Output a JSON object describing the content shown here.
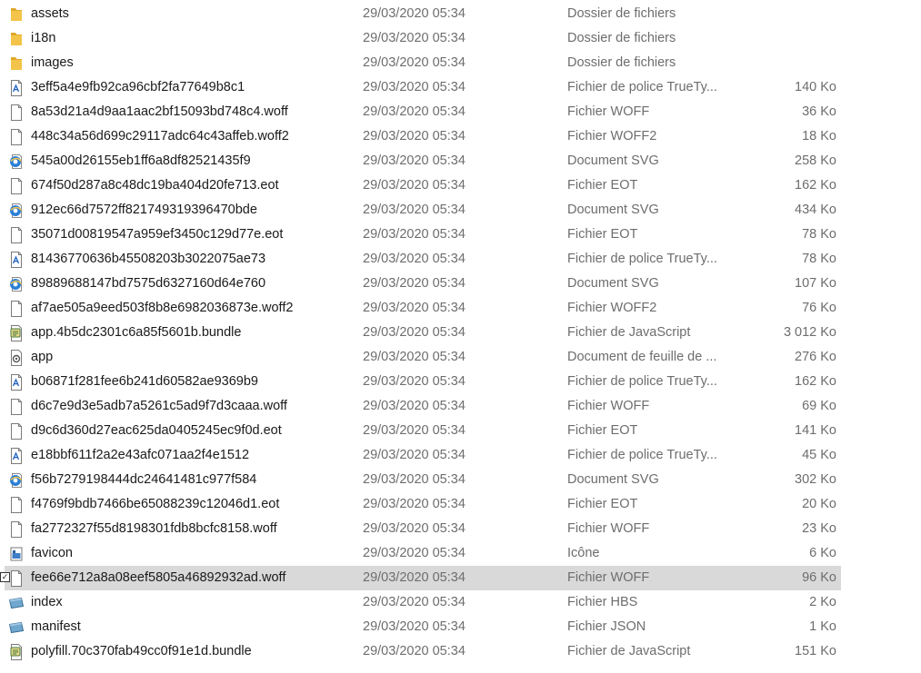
{
  "files": [
    {
      "name": "assets",
      "date": "29/03/2020 05:34",
      "type": "Dossier de fichiers",
      "size": "",
      "icon": "folder-icon"
    },
    {
      "name": "i18n",
      "date": "29/03/2020 05:34",
      "type": "Dossier de fichiers",
      "size": "",
      "icon": "folder-icon"
    },
    {
      "name": "images",
      "date": "29/03/2020 05:34",
      "type": "Dossier de fichiers",
      "size": "",
      "icon": "folder-icon"
    },
    {
      "name": "3eff5a4e9fb92ca96cbf2fa77649b8c1",
      "date": "29/03/2020 05:34",
      "type": "Fichier de police TrueTy...",
      "size": "140 Ko",
      "icon": "font-file-icon"
    },
    {
      "name": "8a53d21a4d9aa1aac2bf15093bd748c4.woff",
      "date": "29/03/2020 05:34",
      "type": "Fichier WOFF",
      "size": "36 Ko",
      "icon": "blank-file-icon"
    },
    {
      "name": "448c34a56d699c29117adc64c43affeb.woff2",
      "date": "29/03/2020 05:34",
      "type": "Fichier WOFF2",
      "size": "18 Ko",
      "icon": "blank-file-icon"
    },
    {
      "name": "545a00d26155eb1ff6a8df82521435f9",
      "date": "29/03/2020 05:34",
      "type": "Document SVG",
      "size": "258 Ko",
      "icon": "browser-document-icon"
    },
    {
      "name": "674f50d287a8c48dc19ba404d20fe713.eot",
      "date": "29/03/2020 05:34",
      "type": "Fichier EOT",
      "size": "162 Ko",
      "icon": "blank-file-icon"
    },
    {
      "name": "912ec66d7572ff821749319396470bde",
      "date": "29/03/2020 05:34",
      "type": "Document SVG",
      "size": "434 Ko",
      "icon": "browser-document-icon"
    },
    {
      "name": "35071d00819547a959ef3450c129d77e.eot",
      "date": "29/03/2020 05:34",
      "type": "Fichier EOT",
      "size": "78 Ko",
      "icon": "blank-file-icon"
    },
    {
      "name": "81436770636b45508203b3022075ae73",
      "date": "29/03/2020 05:34",
      "type": "Fichier de police TrueTy...",
      "size": "78 Ko",
      "icon": "font-file-icon"
    },
    {
      "name": "89889688147bd7575d6327160d64e760",
      "date": "29/03/2020 05:34",
      "type": "Document SVG",
      "size": "107 Ko",
      "icon": "browser-document-icon"
    },
    {
      "name": "af7ae505a9eed503f8b8e6982036873e.woff2",
      "date": "29/03/2020 05:34",
      "type": "Fichier WOFF2",
      "size": "76 Ko",
      "icon": "blank-file-icon"
    },
    {
      "name": "app.4b5dc2301c6a85f5601b.bundle",
      "date": "29/03/2020 05:34",
      "type": "Fichier de JavaScript",
      "size": "3 012 Ko",
      "icon": "script-file-icon"
    },
    {
      "name": "app",
      "date": "29/03/2020 05:34",
      "type": "Document de feuille de ...",
      "size": "276 Ko",
      "icon": "stylesheet-file-icon"
    },
    {
      "name": "b06871f281fee6b241d60582ae9369b9",
      "date": "29/03/2020 05:34",
      "type": "Fichier de police TrueTy...",
      "size": "162 Ko",
      "icon": "font-file-icon"
    },
    {
      "name": "d6c7e9d3e5adb7a5261c5ad9f7d3caaa.woff",
      "date": "29/03/2020 05:34",
      "type": "Fichier WOFF",
      "size": "69 Ko",
      "icon": "blank-file-icon"
    },
    {
      "name": "d9c6d360d27eac625da0405245ec9f0d.eot",
      "date": "29/03/2020 05:34",
      "type": "Fichier EOT",
      "size": "141 Ko",
      "icon": "blank-file-icon"
    },
    {
      "name": "e18bbf611f2a2e43afc071aa2f4e1512",
      "date": "29/03/2020 05:34",
      "type": "Fichier de police TrueTy...",
      "size": "45 Ko",
      "icon": "font-file-icon"
    },
    {
      "name": "f56b7279198444dc24641481c977f584",
      "date": "29/03/2020 05:34",
      "type": "Document SVG",
      "size": "302 Ko",
      "icon": "browser-document-icon"
    },
    {
      "name": "f4769f9bdb7466be65088239c12046d1.eot",
      "date": "29/03/2020 05:34",
      "type": "Fichier EOT",
      "size": "20 Ko",
      "icon": "blank-file-icon"
    },
    {
      "name": "fa2772327f55d8198301fdb8bcfc8158.woff",
      "date": "29/03/2020 05:34",
      "type": "Fichier WOFF",
      "size": "23 Ko",
      "icon": "blank-file-icon"
    },
    {
      "name": "favicon",
      "date": "29/03/2020 05:34",
      "type": "Icône",
      "size": "6 Ko",
      "icon": "image-icon-file-icon"
    },
    {
      "name": "fee66e712a8a08eef5805a46892932ad.woff",
      "date": "29/03/2020 05:34",
      "type": "Fichier WOFF",
      "size": "96 Ko",
      "icon": "blank-file-icon",
      "selected": true
    },
    {
      "name": "index",
      "date": "29/03/2020 05:34",
      "type": "Fichier HBS",
      "size": "2 Ko",
      "icon": "generic-app-file-icon"
    },
    {
      "name": "manifest",
      "date": "29/03/2020 05:34",
      "type": "Fichier JSON",
      "size": "1 Ko",
      "icon": "generic-app-file-icon"
    },
    {
      "name": "polyfill.70c370fab49cc0f91e1d.bundle",
      "date": "29/03/2020 05:34",
      "type": "Fichier de JavaScript",
      "size": "151 Ko",
      "icon": "script-file-icon"
    }
  ],
  "selection_check": "✓",
  "colors": {
    "folder": "#f3c449",
    "selection": "#d9d9d9",
    "secondary_text": "#6d6d6d",
    "browser_blue": "#2b7fd6"
  }
}
